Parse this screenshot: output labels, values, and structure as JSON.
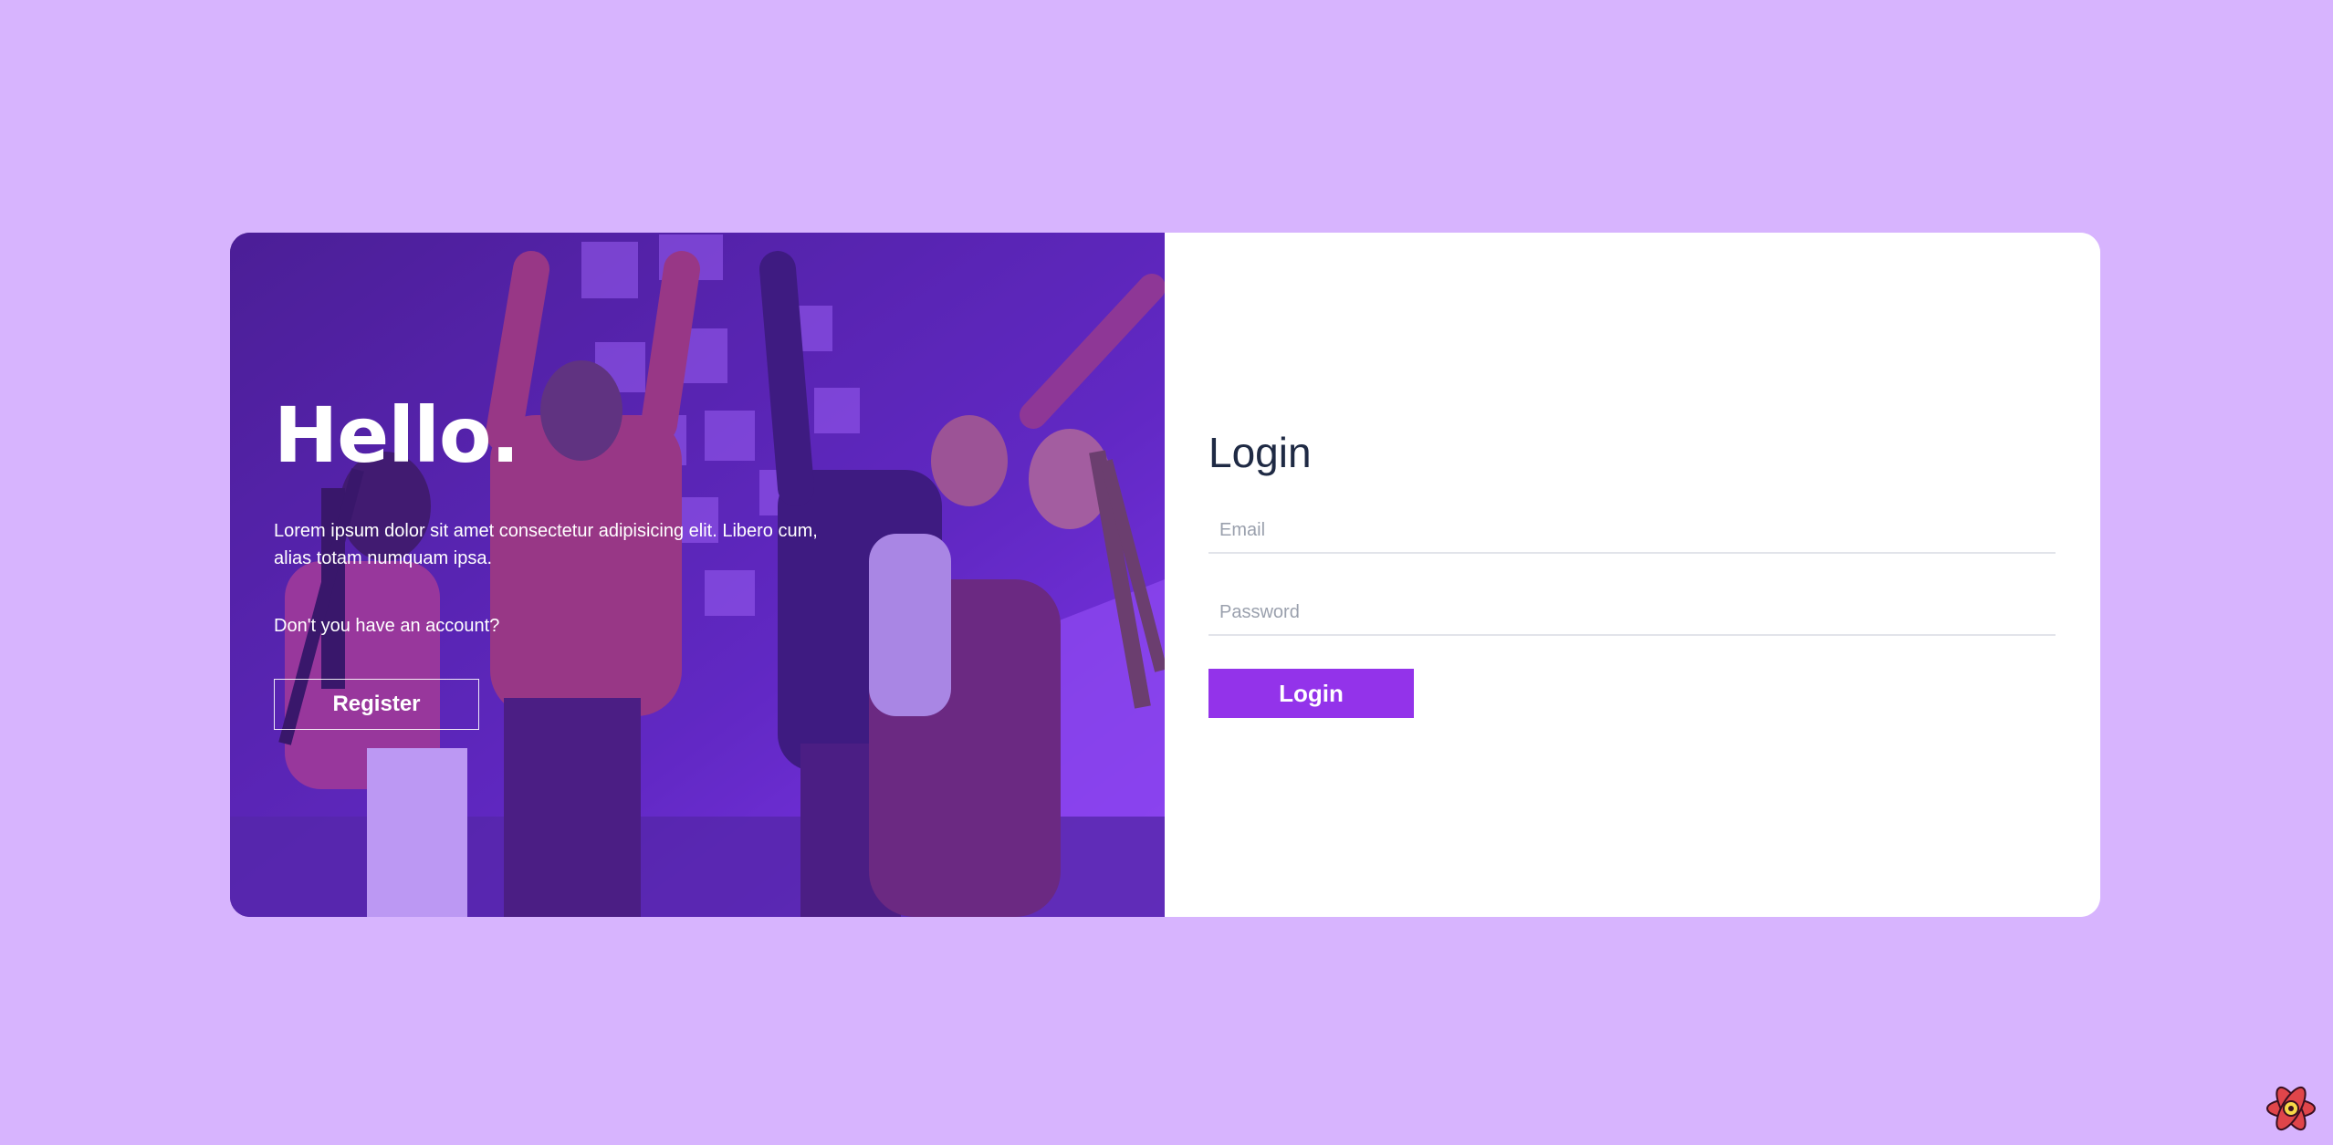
{
  "hero": {
    "title": "Hello.",
    "description": "Lorem ipsum dolor sit amet consectetur adipisicing elit. Libero cum, alias totam numquam ipsa.",
    "question": "Don't you have an account?",
    "register_label": "Register",
    "image_icon": "people-celebrating-photo"
  },
  "login": {
    "title": "Login",
    "email_placeholder": "Email",
    "password_placeholder": "Password",
    "button_label": "Login"
  },
  "colors": {
    "background": "#d7b4fe",
    "accent": "#9333ea",
    "hero_overlay": "#6e28dc"
  },
  "devtools": {
    "icon": "react-devtools-icon"
  }
}
